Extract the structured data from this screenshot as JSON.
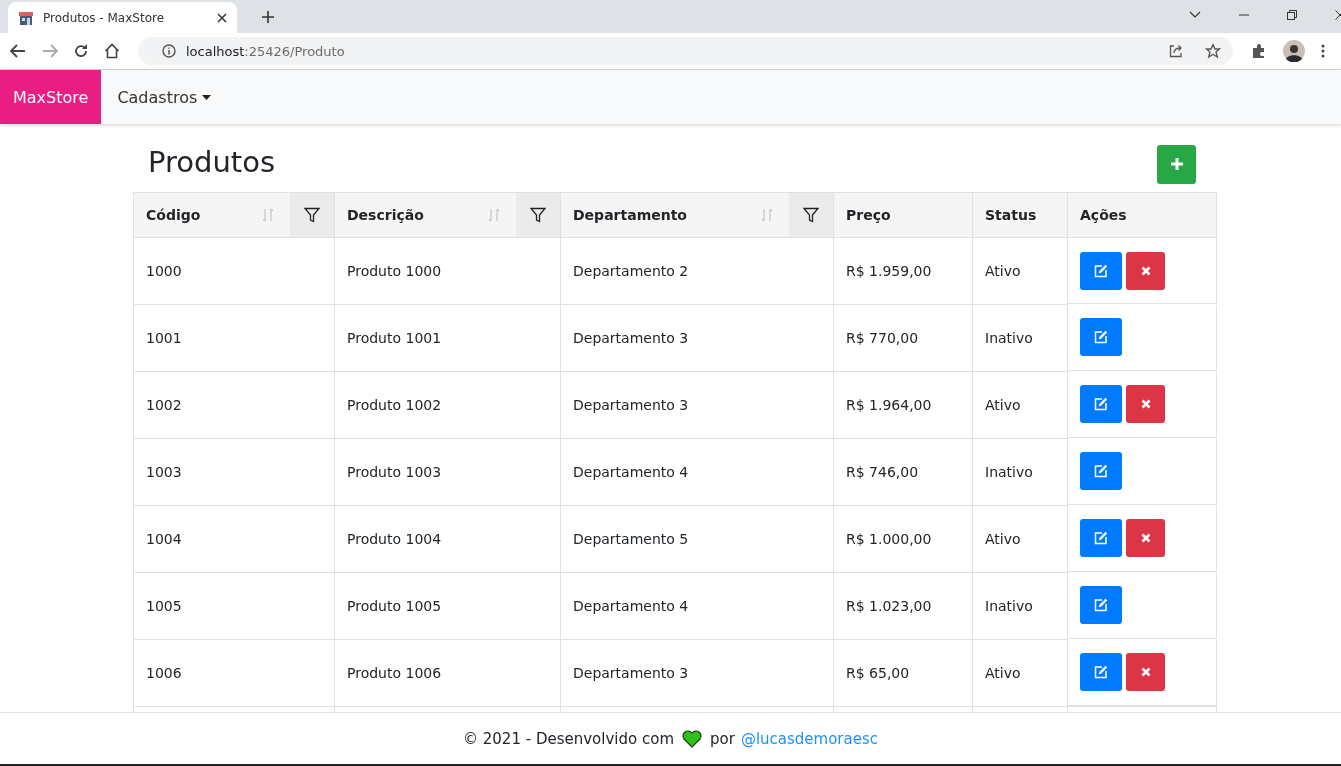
{
  "browser": {
    "tab_title": "Produtos - MaxStore",
    "url_host": "localhost",
    "url_path": ":25426/Produto"
  },
  "navbar": {
    "brand": "MaxStore",
    "menu": [
      {
        "label": "Cadastros",
        "dropdown": true
      }
    ]
  },
  "page": {
    "title": "Produtos"
  },
  "table": {
    "columns": [
      {
        "label": "Código",
        "sortable": true,
        "filterable": true
      },
      {
        "label": "Descrição",
        "sortable": true,
        "filterable": true
      },
      {
        "label": "Departamento",
        "sortable": true,
        "filterable": true
      },
      {
        "label": "Preço",
        "sortable": false,
        "filterable": false
      },
      {
        "label": "Status",
        "sortable": false,
        "filterable": false
      },
      {
        "label": "Ações",
        "sortable": false,
        "filterable": false
      }
    ],
    "rows": [
      {
        "cells": [
          "1000",
          "Produto 1000",
          "Departamento 2",
          "R$ 1.959,00",
          "Ativo"
        ],
        "deletable": true
      },
      {
        "cells": [
          "1001",
          "Produto 1001",
          "Departamento 3",
          "R$ 770,00",
          "Inativo"
        ],
        "deletable": false
      },
      {
        "cells": [
          "1002",
          "Produto 1002",
          "Departamento 3",
          "R$ 1.964,00",
          "Ativo"
        ],
        "deletable": true
      },
      {
        "cells": [
          "1003",
          "Produto 1003",
          "Departamento 4",
          "R$ 746,00",
          "Inativo"
        ],
        "deletable": false
      },
      {
        "cells": [
          "1004",
          "Produto 1004",
          "Departamento 5",
          "R$ 1.000,00",
          "Ativo"
        ],
        "deletable": true
      },
      {
        "cells": [
          "1005",
          "Produto 1005",
          "Departamento 4",
          "R$ 1.023,00",
          "Inativo"
        ],
        "deletable": false
      },
      {
        "cells": [
          "1006",
          "Produto 1006",
          "Departamento 3",
          "R$ 65,00",
          "Ativo"
        ],
        "deletable": true
      }
    ]
  },
  "footer": {
    "text": "© 2021 - Desenvolvido com",
    "by": "por",
    "link": "@lucasdemoraesc"
  }
}
